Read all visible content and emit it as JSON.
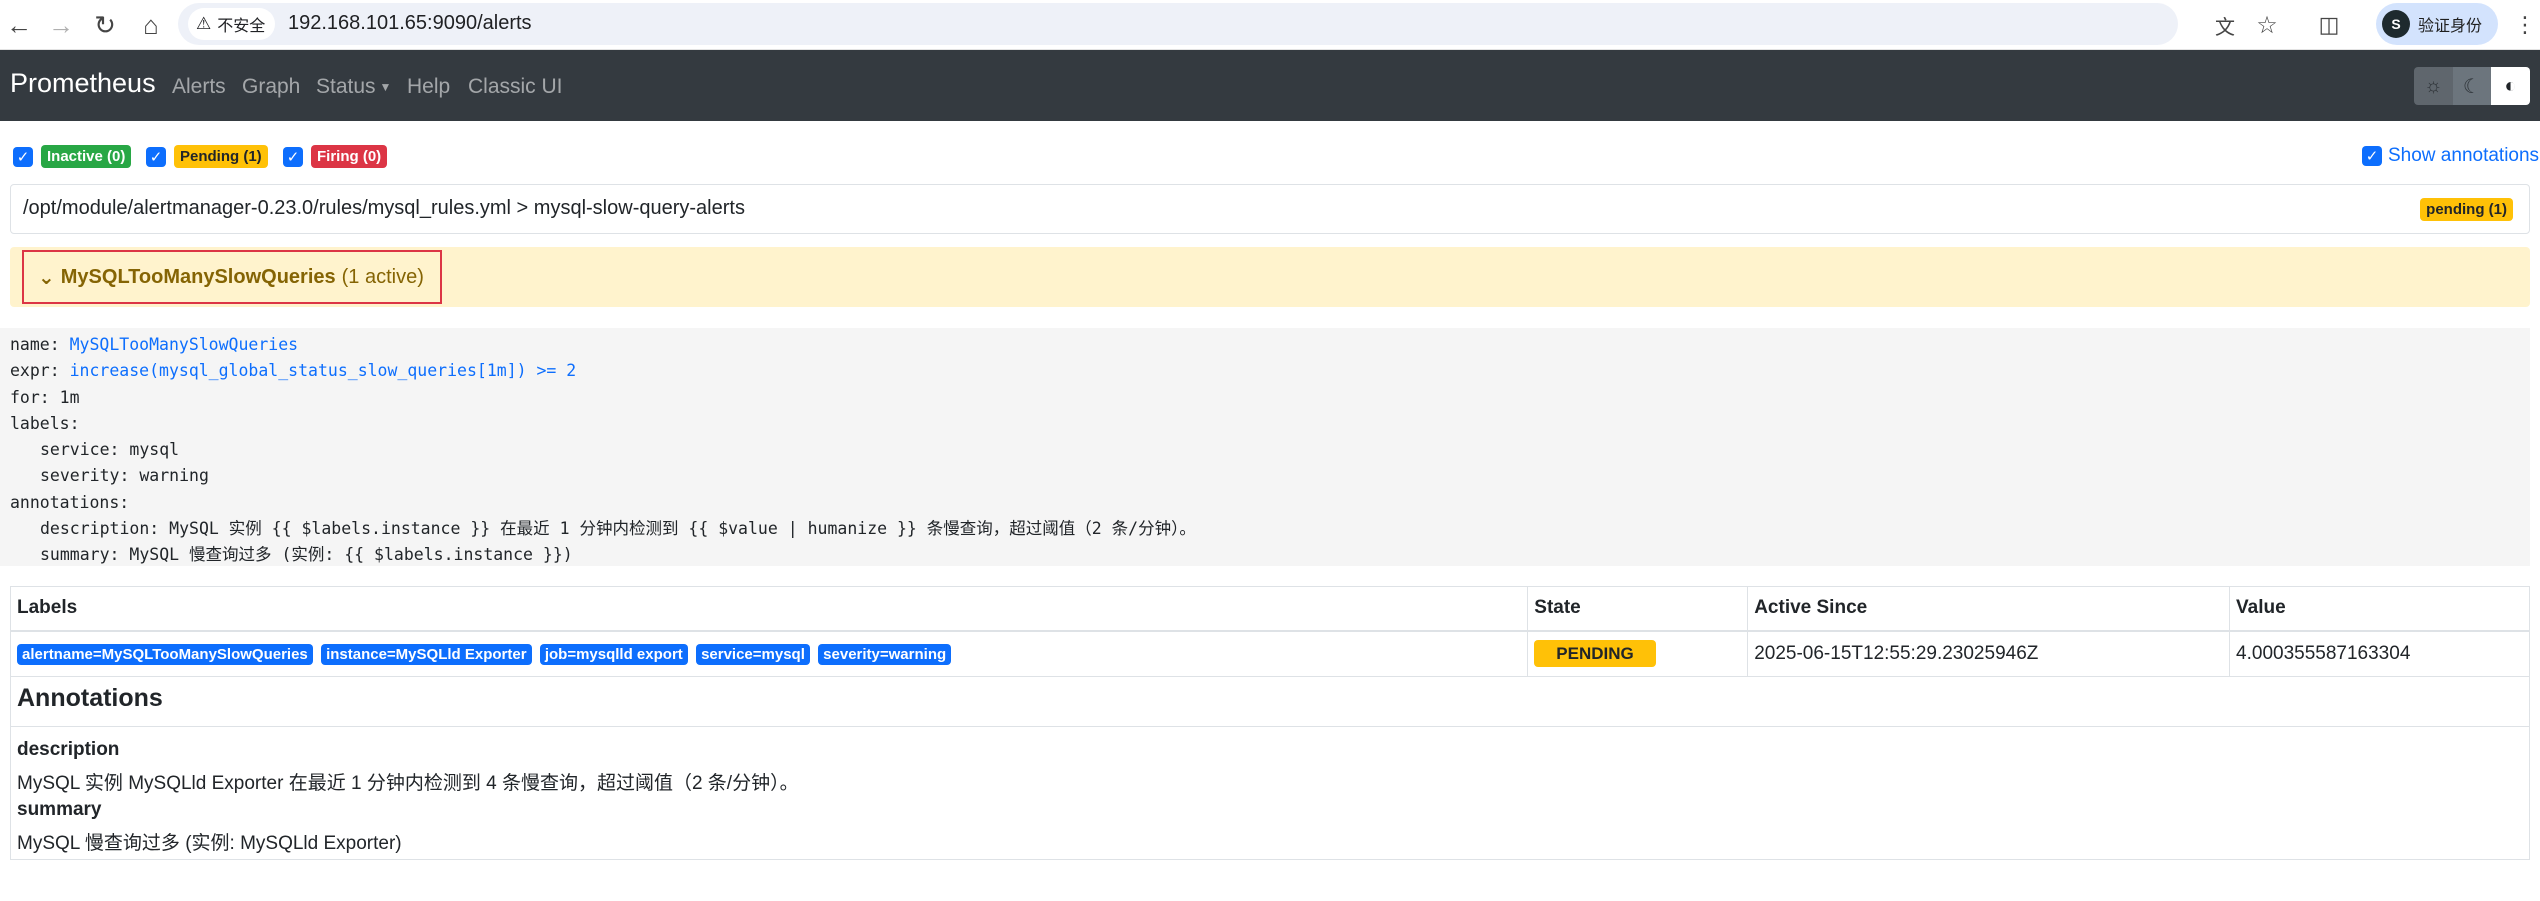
{
  "browser": {
    "security_label": "不安全",
    "url": "192.168.101.65:9090/alerts",
    "profile_label": "验证身份",
    "profile_initial": "S"
  },
  "navbar": {
    "brand": "Prometheus",
    "links": [
      "Alerts",
      "Graph",
      "Status",
      "Help",
      "Classic UI"
    ]
  },
  "filters": {
    "inactive": "Inactive (0)",
    "pending": "Pending (1)",
    "firing": "Firing (0)",
    "show_annotations": "Show annotations"
  },
  "rule_file": {
    "path": "/opt/module/alertmanager-0.23.0/rules/mysql_rules.yml > mysql-slow-query-alerts",
    "badge": "pending (1)"
  },
  "alert": {
    "name": "MySQLTooManySlowQueries",
    "active_count": "(1 active)"
  },
  "rule_def": {
    "name_key": "name: ",
    "name_val": "MySQLTooManySlowQueries",
    "expr_key": "expr: ",
    "expr_val": "increase(mysql_global_status_slow_queries[1m]) >= 2",
    "for_line": "for: 1m",
    "labels_line": "labels:",
    "label_service": "service: mysql",
    "label_severity": "severity: warning",
    "annotations_line": "annotations:",
    "ann_description": "description: MySQL 实例 {{ $labels.instance }} 在最近 1 分钟内检测到 {{ $value | humanize }} 条慢查询，超过阈值（2 条/分钟）。",
    "ann_summary": "summary: MySQL 慢查询过多 (实例: {{ $labels.instance }})"
  },
  "table": {
    "headers": [
      "Labels",
      "State",
      "Active Since",
      "Value"
    ],
    "labels": [
      "alertname=MySQLTooManySlowQueries",
      "instance=MySQLld Exporter",
      "job=mysqlld export",
      "service=mysql",
      "severity=warning"
    ],
    "state": "PENDING",
    "active_since": "2025-06-15T12:55:29.23025946Z",
    "value": "4.000355587163304"
  },
  "annotations": {
    "heading": "Annotations",
    "description_key": "description",
    "description_val": "MySQL 实例 MySQLld Exporter 在最近 1 分钟内检测到 4 条慢查询，超过阈值（2 条/分钟）。",
    "summary_key": "summary",
    "summary_val": "MySQL 慢查询过多 (实例: MySQLld Exporter)"
  }
}
